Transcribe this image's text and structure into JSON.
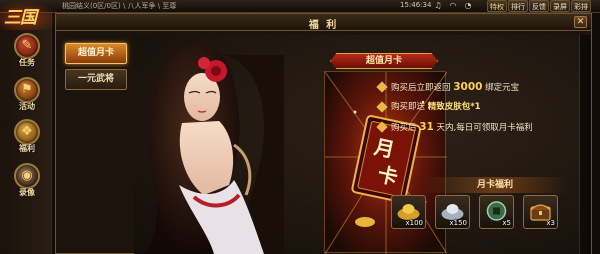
{
  "topbar": {
    "logo_text": "三国",
    "breadcrumb": "桃园结义(0区/0区)  \\  八人军争  \\  至尊",
    "clock": "15:46:34",
    "icons": [
      "music-icon",
      "signal-icon",
      "volume-icon"
    ],
    "links": [
      "特权",
      "排行",
      "反馈",
      "录屏",
      "彩排"
    ]
  },
  "leftnav": {
    "items": [
      {
        "label": "任务",
        "icon": "scroll-icon"
      },
      {
        "label": "活动",
        "icon": "flag-icon"
      },
      {
        "label": "福利",
        "icon": "gift-icon"
      },
      {
        "label": "录像",
        "icon": "camera-icon"
      }
    ]
  },
  "panel": {
    "title": "福 利",
    "close": "✕",
    "tabs": [
      "超值月卡",
      "一元武将"
    ],
    "active_tab": 0
  },
  "card": {
    "banner": "超值月卡",
    "card_text_top": "月",
    "card_text_bottom": "卡"
  },
  "benefits": [
    {
      "pre": "购买后立即返回 ",
      "hl": "3000",
      "post": " 绑定元宝"
    },
    {
      "pre": "购买即送 ",
      "hl": "精致皮肤包*1",
      "post": ""
    },
    {
      "pre": "购买后 ",
      "hl": "31",
      "post": " 天内,每日可领取月卡福利"
    }
  ],
  "rewards": {
    "title": "月卡福利",
    "items": [
      {
        "name": "gold-ingot-icon",
        "count": "x100"
      },
      {
        "name": "silver-ingot-icon",
        "count": "x150"
      },
      {
        "name": "coin-icon",
        "count": "x5"
      },
      {
        "name": "chest-icon",
        "count": "x3"
      }
    ]
  },
  "colors": {
    "accent": "#e08a2a",
    "banner": "#b52a16",
    "highlight": "#ffd34d"
  }
}
